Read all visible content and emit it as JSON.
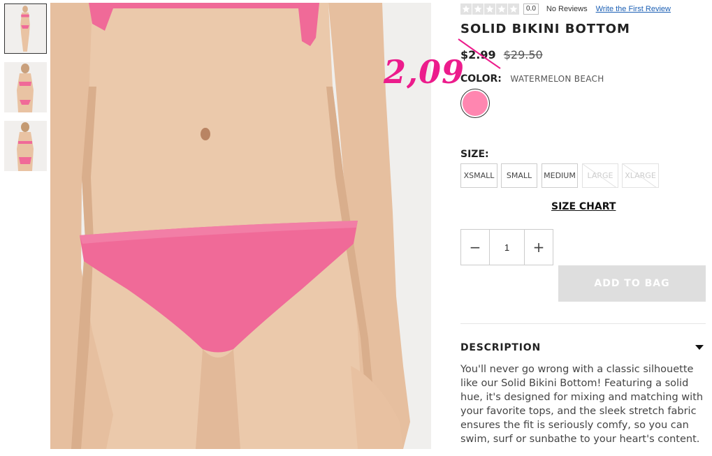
{
  "thumbnails": [
    "thumbnail-front",
    "thumbnail-top-front",
    "thumbnail-back"
  ],
  "rating": {
    "stars": 0,
    "score": "0.0",
    "no_reviews": "No Reviews",
    "write_review": "Write the First Review"
  },
  "product": {
    "title": "SOLID BIKINI BOTTOM",
    "sale_price": "$2.99",
    "original_price": "$29.50",
    "handwritten_price": "2,09"
  },
  "color": {
    "label": "COLOR:",
    "name": "WATERMELON BEACH",
    "swatch_hex": "#ff86b0"
  },
  "size": {
    "label": "SIZE:",
    "options": [
      {
        "label": "XSMALL",
        "available": true
      },
      {
        "label": "SMALL",
        "available": true
      },
      {
        "label": "MEDIUM",
        "available": true
      },
      {
        "label": "LARGE",
        "available": false
      },
      {
        "label": "XLARGE",
        "available": false
      }
    ],
    "chart_link": "SIZE CHART"
  },
  "quantity": {
    "minus": "−",
    "value": "1",
    "plus": "+"
  },
  "cart": {
    "add_label": "ADD TO BAG"
  },
  "description": {
    "heading": "DESCRIPTION",
    "text": "You'll never go wrong with a classic silhouette like our Solid Bikini Bottom! Featuring a solid hue, it's designed for mixing and matching with your favorite tops, and the sleek stretch fabric ensures the fit is seriously comfy, so you can swim, surf or sunbathe to your heart's content."
  },
  "colors": {
    "bikini": "#f06a98",
    "skin": "#eac6a8",
    "annotation": "#ec1c8c",
    "accent_link": "#1b5fb4"
  }
}
